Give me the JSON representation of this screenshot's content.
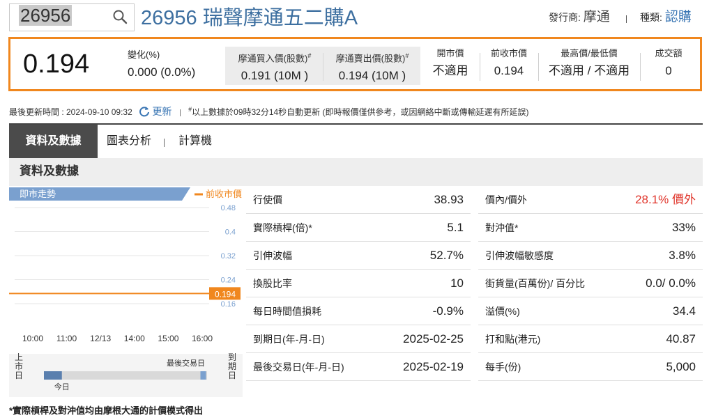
{
  "search": {
    "value": "26956"
  },
  "header": {
    "title": "26956 瑞聲摩通五二購A",
    "issuer_label": "發行商:",
    "issuer": "摩通",
    "type_label": "種類:",
    "type": "認購"
  },
  "quote": {
    "price": "0.194",
    "change_label": "變化(%)",
    "change_value": "0.000 (0.0%)",
    "bid_label": "摩通買入價(股數)",
    "bid_sup": "#",
    "bid_value": "0.191 (10M )",
    "ask_label": "摩通賣出價(股數)",
    "ask_sup": "#",
    "ask_value": "0.194 (10M )",
    "open_label": "開市價",
    "open_value": "不適用",
    "prev_close_label": "前收市價",
    "prev_close_value": "0.194",
    "high_low_label": "最高價/最低價",
    "high_low_value": "不適用 / 不適用",
    "turnover_label": "成交額",
    "turnover_value": "0"
  },
  "update": {
    "last_update": "最後更新時間 : 2024-09-10 09:32",
    "refresh_label": "更新",
    "note_sup": "#",
    "note": "以上數據於09時32分14秒自動更新 (即時報價僅供參考，或因網絡中斷或傳輸延遲有所延誤)"
  },
  "tabs": [
    {
      "label": "資料及數據"
    },
    {
      "label": "圖表分析"
    },
    {
      "label": "計算機"
    }
  ],
  "section_title": "資料及數據",
  "chart": {
    "title": "即市走勢",
    "legend": "前收市價",
    "price_tag": "0.194",
    "timeline_left": "上市日",
    "timeline_right": "到期日",
    "timeline_today": "今日",
    "timeline_last": "最後交易日",
    "colors": {
      "line": "#f0871e",
      "accent": "#7aa0cf"
    }
  },
  "chart_data": {
    "type": "line",
    "title": "即市走勢",
    "x": [
      "10:00",
      "11:00",
      "12/13",
      "14:00",
      "15:00",
      "16:00"
    ],
    "y_ticks": [
      "0.48",
      "0.4",
      "0.32",
      "0.24",
      "0.16"
    ],
    "ylim": [
      0.16,
      0.48
    ],
    "series": [
      {
        "name": "前收市價",
        "values": [
          0.194,
          0.194,
          0.194,
          0.194,
          0.194,
          0.194
        ]
      }
    ],
    "grid": true,
    "legend": "top-right"
  },
  "timeline": {
    "elapsed_fraction": 0.11,
    "last_trading_fraction": 0.985
  },
  "table_left": [
    {
      "k": "行使價",
      "v": "38.93"
    },
    {
      "k": "實際槓桿(倍)*",
      "v": "5.1"
    },
    {
      "k": "引伸波幅",
      "v": "52.7%"
    },
    {
      "k": "換股比率",
      "v": "10"
    },
    {
      "k": "每日時間值損耗",
      "v": "-0.9%"
    },
    {
      "k": "到期日(年-月-日)",
      "v": "2025-02-25"
    },
    {
      "k": "最後交易日(年-月-日)",
      "v": "2025-02-19"
    }
  ],
  "table_right": [
    {
      "k": "價內/價外",
      "v": "28.1% 價外"
    },
    {
      "k": "對沖值*",
      "v": "33%"
    },
    {
      "k": "引伸波幅敏感度",
      "v": "3.8%"
    },
    {
      "k": "街貨量(百萬份)/ 百分比",
      "v": "0.0/ 0.0%"
    },
    {
      "k": "溢價(%)",
      "v": "34.4"
    },
    {
      "k": "打和點(港元)",
      "v": "40.87"
    },
    {
      "k": "每手(份)",
      "v": "5,000"
    }
  ],
  "table_colors": {
    "highlight": "#e0352b"
  },
  "footnote": "*實際槓桿及對沖值均由摩根大通的計價模式得出"
}
